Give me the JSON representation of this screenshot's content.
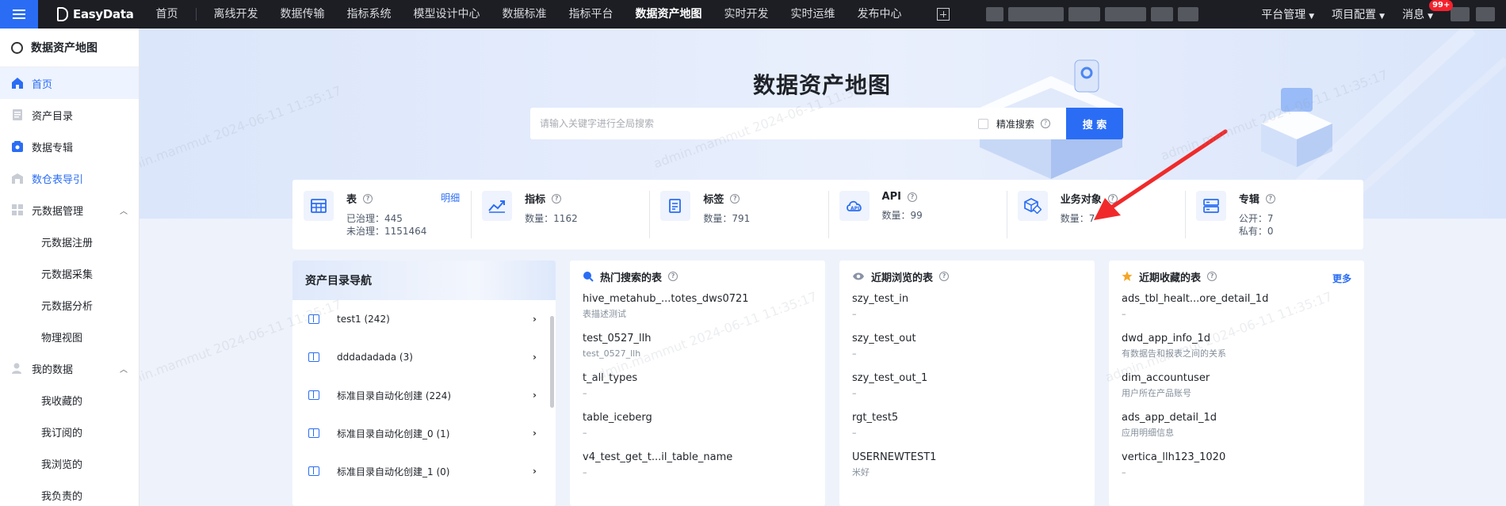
{
  "topbar": {
    "logo": "EasyData",
    "nav": [
      "首页",
      "离线开发",
      "数据传输",
      "指标系统",
      "模型设计中心",
      "数据标准",
      "指标平台",
      "数据资产地图",
      "实时开发",
      "实时运维",
      "发布中心"
    ],
    "active": "数据资产地图",
    "right": {
      "platform": "平台管理",
      "project": "项目配置",
      "messages": "消息",
      "badge": "99+"
    }
  },
  "sidebar": {
    "title": "数据资产地图",
    "items": [
      {
        "label": "首页",
        "icon": "home-icon"
      },
      {
        "label": "资产目录",
        "icon": "catalog-icon"
      },
      {
        "label": "数据专辑",
        "icon": "album-icon"
      },
      {
        "label": "数仓表导引",
        "icon": "warehouse-icon"
      },
      {
        "label": "元数据管理",
        "icon": "grid-icon"
      },
      {
        "label": "元数据注册"
      },
      {
        "label": "元数据采集"
      },
      {
        "label": "元数据分析"
      },
      {
        "label": "物理视图"
      },
      {
        "label": "我的数据",
        "icon": "user-icon"
      },
      {
        "label": "我收藏的"
      },
      {
        "label": "我订阅的"
      },
      {
        "label": "我浏览的"
      },
      {
        "label": "我负责的"
      }
    ]
  },
  "hero": {
    "title": "数据资产地图",
    "search_placeholder": "请输入关键字进行全局搜索",
    "exact_label": "精准搜索",
    "search_button": "搜 索"
  },
  "stats": [
    {
      "name": "表",
      "link": "明细",
      "lines": [
        "已治理：445",
        "未治理：1151464"
      ],
      "icon": "table-icon"
    },
    {
      "name": "指标",
      "lines": [
        "数量：1162"
      ],
      "icon": "metric-icon"
    },
    {
      "name": "标签",
      "lines": [
        "数量：791"
      ],
      "icon": "tag-icon"
    },
    {
      "name": "API",
      "lines": [
        "数量：99"
      ],
      "icon": "api-icon"
    },
    {
      "name": "业务对象",
      "lines": [
        "数量：7"
      ],
      "icon": "business-object-icon"
    },
    {
      "name": "专辑",
      "lines": [
        "公开：7",
        "私有：0"
      ],
      "icon": "album-icon"
    }
  ],
  "catalog_nav": {
    "title": "资产目录导航",
    "items": [
      "test1 (242)",
      "dddadadada (3)",
      "标准目录自动化创建 (224)",
      "标准目录自动化创建_0 (1)",
      "标准目录自动化创建_1 (0)"
    ]
  },
  "hot_search": {
    "title": "热门搜索的表",
    "items": [
      {
        "name": "hive_metahub_...totes_dws0721",
        "desc": "表描述测试"
      },
      {
        "name": "test_0527_llh",
        "desc": "test_0527_llh"
      },
      {
        "name": "t_all_types",
        "desc": "–"
      },
      {
        "name": "table_iceberg",
        "desc": "–"
      },
      {
        "name": "v4_test_get_t...il_table_name",
        "desc": "–"
      }
    ]
  },
  "recent": {
    "title": "近期浏览的表",
    "items": [
      {
        "name": "szy_test_in",
        "desc": "–"
      },
      {
        "name": "szy_test_out",
        "desc": "–"
      },
      {
        "name": "szy_test_out_1",
        "desc": "–"
      },
      {
        "name": "rgt_test5",
        "desc": "–"
      },
      {
        "name": "USERNEWTEST1",
        "desc": "米好"
      }
    ]
  },
  "favorites": {
    "title": "近期收藏的表",
    "more": "更多",
    "items": [
      {
        "name": "ads_tbl_healt...ore_detail_1d",
        "desc": "–"
      },
      {
        "name": "dwd_app_info_1d",
        "desc": "有数据告和报表之间的关系"
      },
      {
        "name": "dim_accountuser",
        "desc": "用户所在产品账号"
      },
      {
        "name": "ads_app_detail_1d",
        "desc": "应用明细信息"
      },
      {
        "name": "vertica_llh123_1020",
        "desc": "–"
      }
    ]
  },
  "watermark": "admin.mammut 2024-06-11 11:35:17",
  "colors": {
    "brand": "#2a6df4",
    "topbar": "#1c1e24",
    "annotation_arrow": "#f02a2a"
  }
}
